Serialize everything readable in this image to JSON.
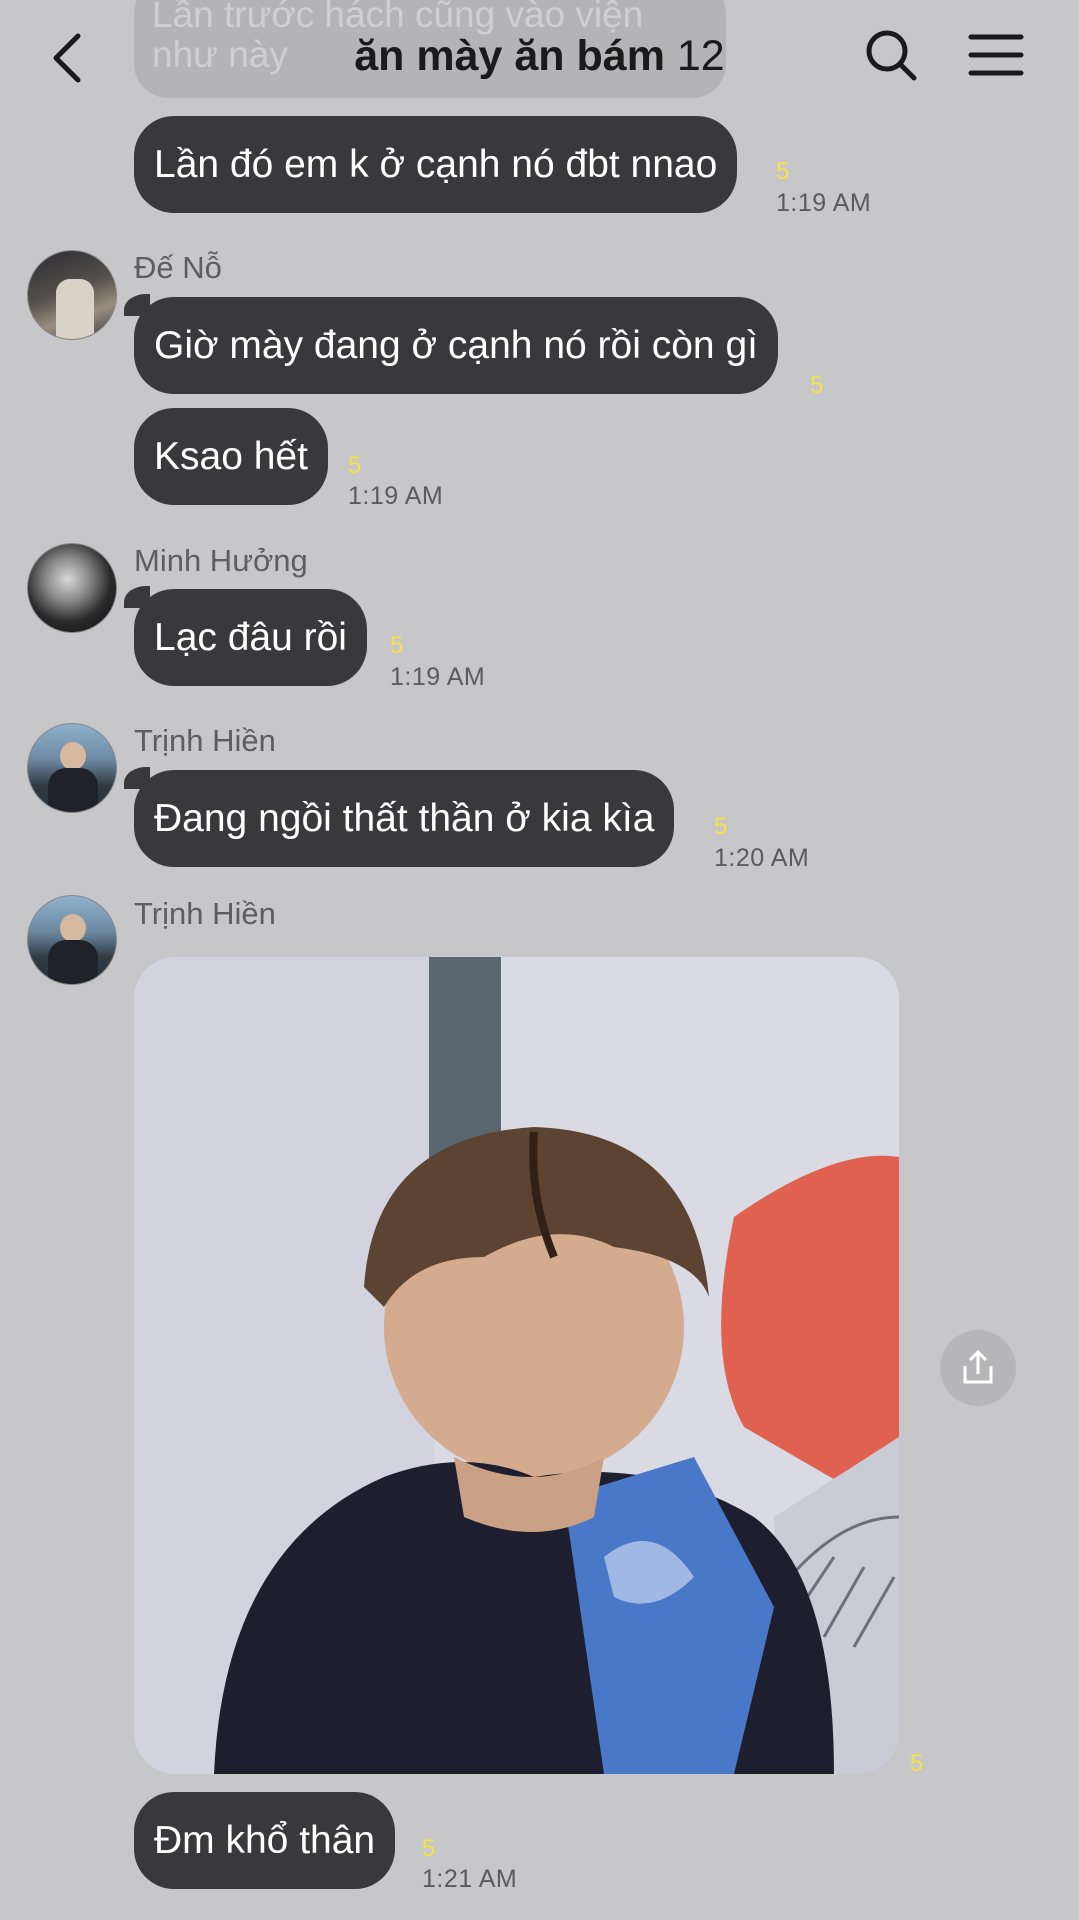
{
  "header": {
    "title": "ăn mày ăn bám",
    "member_count": "12",
    "back_icon": "chevron-left-icon",
    "search_icon": "search-icon",
    "menu_icon": "hamburger-menu-icon"
  },
  "messages": {
    "partial_top": {
      "line1": "Lần trước hách cũng vào viện",
      "line2": "như này"
    },
    "m1": {
      "text": "Lần đó em k ở cạnh nó đbt nnao",
      "unread": "5",
      "time": "1:19 AM"
    },
    "m2": {
      "sender": "Đế Nỗ",
      "text": "Giờ mày đang ở cạnh nó rồi còn gì",
      "unread": "5"
    },
    "m3": {
      "text": "Ksao hết",
      "unread": "5",
      "time": "1:19 AM"
    },
    "m4": {
      "sender": "Minh Hưởng",
      "text": "Lạc đâu rồi",
      "unread": "5",
      "time": "1:19 AM"
    },
    "m5": {
      "sender": "Trịnh Hiền",
      "text": "Đang ngồi thất thần ở kia kìa",
      "unread": "5",
      "time": "1:20 AM"
    },
    "m6": {
      "sender": "Trịnh Hiền",
      "image_alt": "photo of a boy with head bowed",
      "unread": "5"
    },
    "m7": {
      "text": "Đm khổ thân",
      "unread": "5",
      "time": "1:21 AM"
    }
  },
  "share_icon": "share-upload-icon",
  "colors": {
    "background": "#c7c7c9",
    "bubble": "#39393b",
    "unread": "#f4e24a"
  }
}
